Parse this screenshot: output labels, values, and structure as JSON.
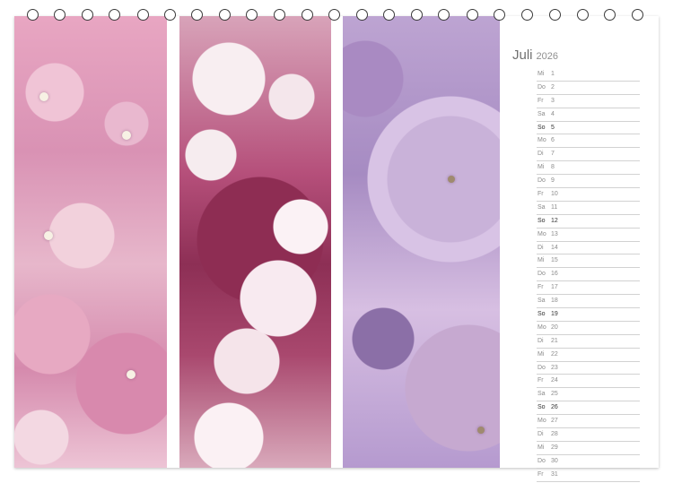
{
  "calendar": {
    "month": "Juli",
    "year": "2026",
    "days": [
      {
        "dn": "Mi",
        "num": "1"
      },
      {
        "dn": "Do",
        "num": "2"
      },
      {
        "dn": "Fr",
        "num": "3"
      },
      {
        "dn": "Sa",
        "num": "4"
      },
      {
        "dn": "So",
        "num": "5"
      },
      {
        "dn": "Mo",
        "num": "6"
      },
      {
        "dn": "Di",
        "num": "7"
      },
      {
        "dn": "Mi",
        "num": "8"
      },
      {
        "dn": "Do",
        "num": "9"
      },
      {
        "dn": "Fr",
        "num": "10"
      },
      {
        "dn": "Sa",
        "num": "11"
      },
      {
        "dn": "So",
        "num": "12"
      },
      {
        "dn": "Mo",
        "num": "13"
      },
      {
        "dn": "Di",
        "num": "14"
      },
      {
        "dn": "Mi",
        "num": "15"
      },
      {
        "dn": "Do",
        "num": "16"
      },
      {
        "dn": "Fr",
        "num": "17"
      },
      {
        "dn": "Sa",
        "num": "18"
      },
      {
        "dn": "So",
        "num": "19"
      },
      {
        "dn": "Mo",
        "num": "20"
      },
      {
        "dn": "Di",
        "num": "21"
      },
      {
        "dn": "Mi",
        "num": "22"
      },
      {
        "dn": "Do",
        "num": "23"
      },
      {
        "dn": "Fr",
        "num": "24"
      },
      {
        "dn": "Sa",
        "num": "25"
      },
      {
        "dn": "So",
        "num": "26"
      },
      {
        "dn": "Mo",
        "num": "27"
      },
      {
        "dn": "Di",
        "num": "28"
      },
      {
        "dn": "Mi",
        "num": "29"
      },
      {
        "dn": "Do",
        "num": "30"
      },
      {
        "dn": "Fr",
        "num": "31"
      }
    ]
  },
  "colors": {
    "sunday_text": "#333333",
    "weekday_text": "#8c8c8c",
    "rule": "#d2d2d2",
    "ring": "#3a3a3a"
  },
  "photos": [
    {
      "name": "pink-hydrangea-photo"
    },
    {
      "name": "cherry-blossom-photo"
    },
    {
      "name": "lilac-hydrangea-photo"
    }
  ]
}
